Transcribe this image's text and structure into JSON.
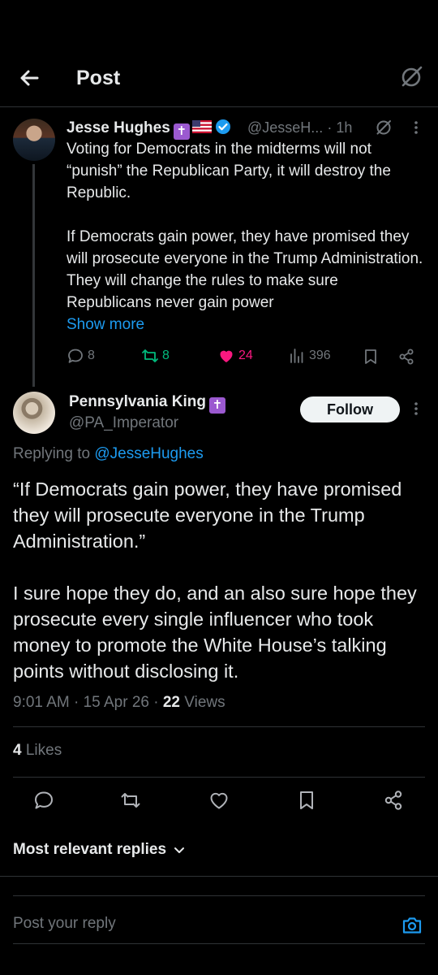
{
  "header": {
    "title": "Post",
    "back_icon": "arrow-left-icon",
    "grok_icon": "grok-icon"
  },
  "parent_post": {
    "author_name": "Jesse Hughes",
    "badge_cross": "✝",
    "handle": "@JesseH...",
    "time": "1h",
    "paragraphs": [
      "Voting for Democrats in the midterms will not “punish” the Republican Party, it will destroy the Republic.",
      "If Democrats gain power, they have promised they will prosecute everyone in the Trump Administration. They will change the rules to make sure Republicans never gain power"
    ],
    "show_more": "Show more",
    "replies": "8",
    "reposts": "8",
    "likes": "24",
    "views": "396",
    "colors": {
      "reposts": "#00ba7c",
      "likes": "#f91880",
      "link": "#1d9bf0"
    }
  },
  "reply_post": {
    "author_name": "Pennsylvania King",
    "badge_cross": "✝",
    "handle": "@PA_Imperator",
    "follow_label": "Follow",
    "replying_prefix": "Replying to",
    "replying_to": "@JesseHughes",
    "paragraphs": [
      "“If Democrats gain power, they have promised they will prosecute everyone in the Trump Administration.”",
      "I sure hope they do, and an also sure hope they prosecute every single influencer who took money to promote the White House’s talking points without disclosing it."
    ],
    "time": "9:01 AM",
    "date": "15 Apr 26",
    "sep": "·",
    "views_count": "22",
    "views_label": "Views",
    "likes_count": "4",
    "likes_label": "Likes"
  },
  "actions": [
    "reply-icon",
    "repost-icon",
    "like-icon",
    "bookmark-icon",
    "share-icon"
  ],
  "sort": {
    "label": "Most relevant replies"
  },
  "composer": {
    "placeholder": "Post your reply"
  }
}
